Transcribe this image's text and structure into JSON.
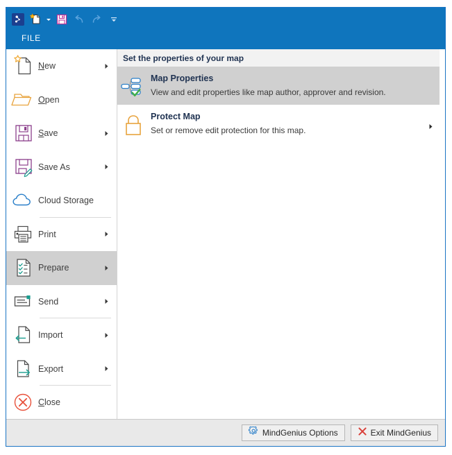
{
  "window": {
    "accent_color": "#0f75bd",
    "border_color": "#1a74c4",
    "tab_label": "FILE"
  },
  "quick_access_toolbar": {
    "items": [
      {
        "name": "app-logo-icon",
        "label": "MindGenius"
      },
      {
        "name": "new-map-icon",
        "label": "New"
      },
      {
        "name": "new-map-dropdown-icon",
        "label": "New options"
      },
      {
        "name": "save-icon",
        "label": "Save"
      },
      {
        "name": "undo-icon",
        "label": "Undo"
      },
      {
        "name": "redo-icon",
        "label": "Redo"
      },
      {
        "name": "customize-toolbar-icon",
        "label": "Customize Quick Access Toolbar"
      }
    ]
  },
  "sidebar": {
    "items": [
      {
        "label": "New",
        "accel": "N",
        "arrow": true,
        "selected": false,
        "separator_before": false,
        "icon": "new-document-icon"
      },
      {
        "label": "Open",
        "accel": "O",
        "arrow": false,
        "selected": false,
        "separator_before": false,
        "icon": "open-folder-icon"
      },
      {
        "label": "Save",
        "accel": "S",
        "arrow": true,
        "selected": false,
        "separator_before": false,
        "icon": "save-floppy-icon"
      },
      {
        "label": "Save As",
        "accel": "",
        "arrow": true,
        "selected": false,
        "separator_before": false,
        "icon": "save-as-icon"
      },
      {
        "label": "Cloud Storage",
        "accel": "",
        "arrow": false,
        "selected": false,
        "separator_before": false,
        "icon": "cloud-icon"
      },
      {
        "label": "Print",
        "accel": "",
        "arrow": true,
        "selected": false,
        "separator_before": true,
        "icon": "printer-icon"
      },
      {
        "label": "Prepare",
        "accel": "",
        "arrow": true,
        "selected": true,
        "separator_before": false,
        "icon": "prepare-checklist-icon"
      },
      {
        "label": "Send",
        "accel": "",
        "arrow": true,
        "selected": false,
        "separator_before": false,
        "icon": "send-envelope-icon"
      },
      {
        "label": "Import",
        "accel": "",
        "arrow": true,
        "selected": false,
        "separator_before": true,
        "icon": "import-icon"
      },
      {
        "label": "Export",
        "accel": "",
        "arrow": true,
        "selected": false,
        "separator_before": false,
        "icon": "export-icon"
      },
      {
        "label": "Close",
        "accel": "C",
        "arrow": false,
        "selected": false,
        "separator_before": true,
        "icon": "close-circle-icon"
      }
    ]
  },
  "content": {
    "header": "Set the properties of your map",
    "commands": [
      {
        "title": "Map Properties",
        "description": "View and edit properties like map author, approver and revision.",
        "selected": true,
        "arrow": false,
        "icon": "map-properties-icon"
      },
      {
        "title": "Protect Map",
        "description": "Set or remove edit protection for this map.",
        "selected": false,
        "arrow": true,
        "icon": "padlock-icon"
      }
    ]
  },
  "bottom_bar": {
    "options_button": "MindGenius Options",
    "exit_button": "Exit MindGenius"
  }
}
